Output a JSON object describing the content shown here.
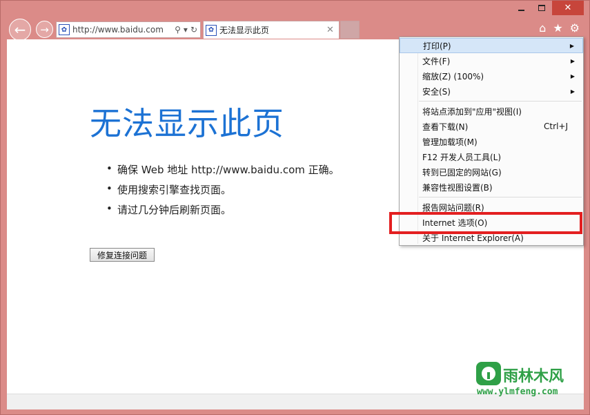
{
  "window": {
    "caption": {
      "minimize": "",
      "maximize": "",
      "close": "✕"
    }
  },
  "nav": {
    "back_icon": "←",
    "forward_icon": "→"
  },
  "address": {
    "url": "http://www.baidu.com",
    "search_icon": "⚲",
    "dropdown_icon": "▾",
    "refresh_icon": "↻"
  },
  "tab": {
    "title": "无法显示此页",
    "close": "✕"
  },
  "toolbar": {
    "home_icon": "⌂",
    "favorites_icon": "★",
    "settings_icon": "⚙"
  },
  "page": {
    "title": "无法显示此页",
    "bullets": [
      "确保 Web 地址 http://www.baidu.com 正确。",
      "使用搜索引擎查找页面。",
      "请过几分钟后刷新页面。"
    ],
    "fix_button": "修复连接问题"
  },
  "menu": {
    "items": [
      {
        "label": "打印(P)",
        "submenu": true,
        "highlighted": true
      },
      {
        "label": "文件(F)",
        "submenu": true
      },
      {
        "label": "缩放(Z) (100%)",
        "submenu": true
      },
      {
        "label": "安全(S)",
        "submenu": true
      },
      {
        "label": "将站点添加到\"应用\"视图(I)"
      },
      {
        "label": "查看下载(N)",
        "shortcut": "Ctrl+J"
      },
      {
        "label": "管理加载项(M)"
      },
      {
        "label": "F12 开发人员工具(L)"
      },
      {
        "label": "转到已固定的网站(G)"
      },
      {
        "label": "兼容性视图设置(B)"
      },
      {
        "label": "报告网站问题(R)"
      },
      {
        "label": "Internet 选项(O)",
        "annotated": true
      },
      {
        "label": "关于 Internet Explorer(A)"
      }
    ],
    "arrow": "▶"
  },
  "watermark": {
    "name": "雨林木风",
    "url": "www.ylmfeng.com"
  },
  "colors": {
    "frame": "#db8b88",
    "title_blue": "#1c72d4",
    "annotation_red": "#e31f20",
    "watermark_green": "#2fa047"
  }
}
